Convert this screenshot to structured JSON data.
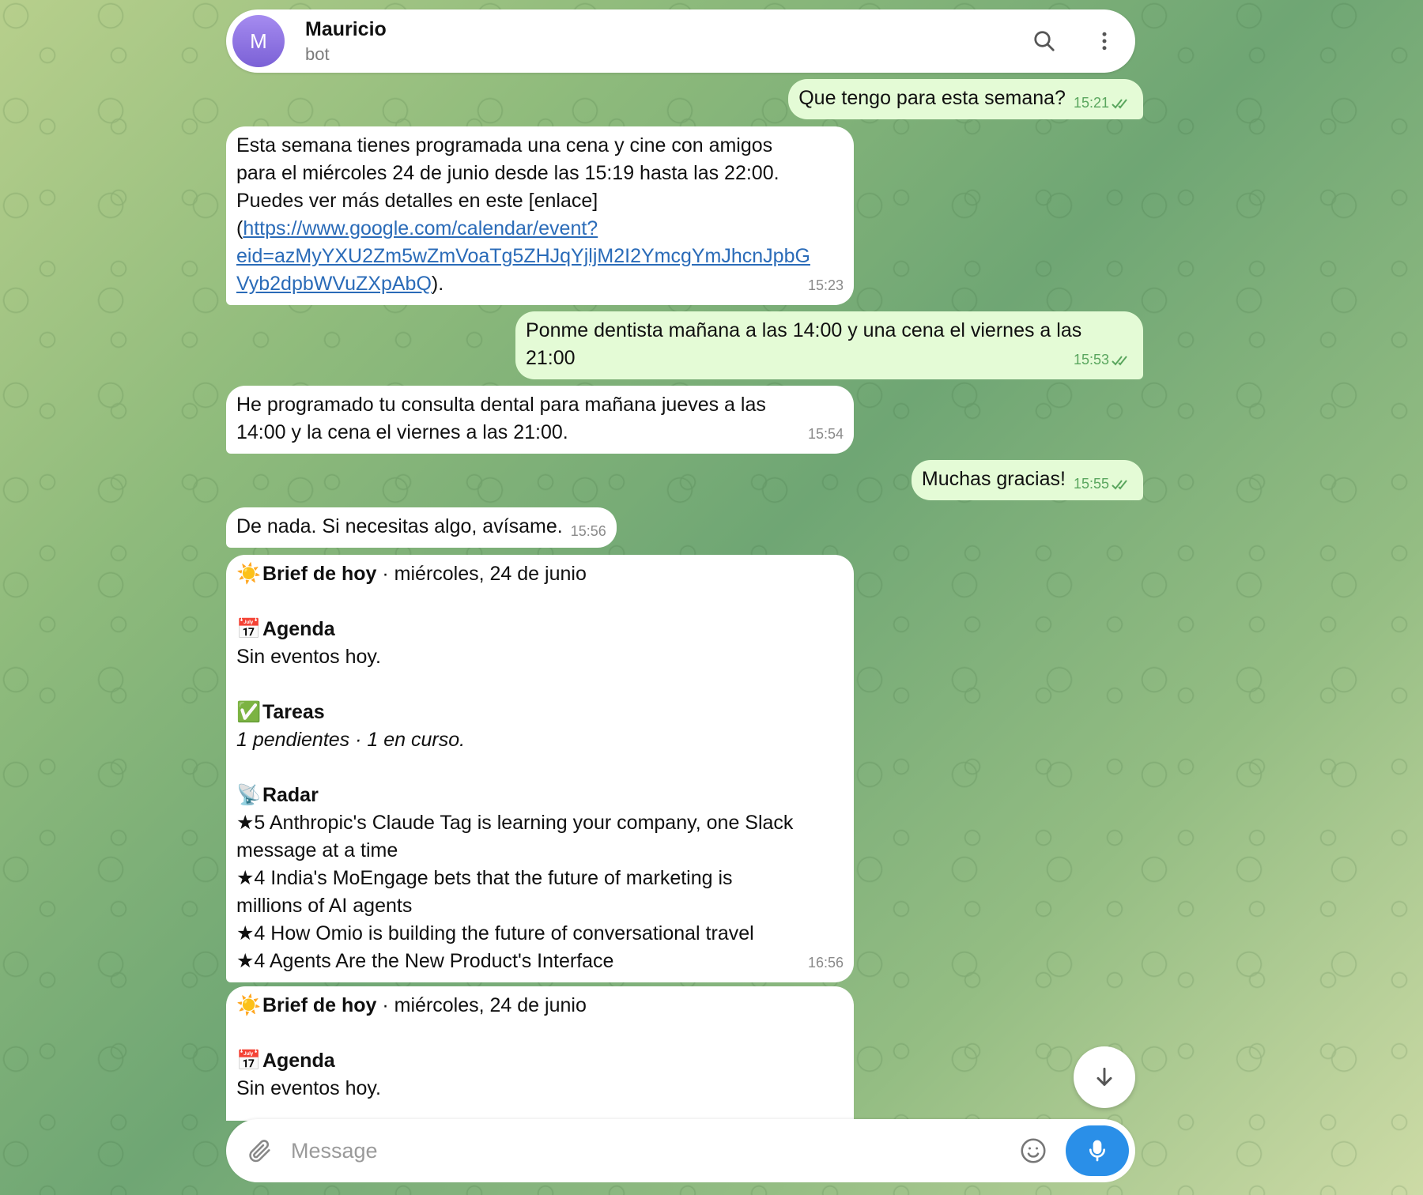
{
  "header": {
    "avatar_letter": "M",
    "name": "Mauricio",
    "subtitle": "bot"
  },
  "messages": {
    "m1": {
      "text": "Que tengo para esta semana?",
      "time": "15:21"
    },
    "m2": {
      "line1": "Esta semana tienes programada una cena y cine con amigos",
      "line2": "para el miércoles 24 de junio desde las 15:19 hasta las 22:00.",
      "line3": "Puedes ver más detalles en este [enlace]",
      "link_open": "(",
      "link_a": "https://www.google.com/calendar/event?",
      "link_b": "eid=azMyYXU2Zm5wZmVoaTg5ZHJqYjljM2I2YmcgYmJhcnJpbG",
      "link_c": "Vyb2dpbWVuZXpAbQ",
      "link_close": ").",
      "time": "15:23"
    },
    "m3": {
      "line1": "Ponme dentista mañana a las 14:00 y una cena el viernes a las",
      "line2": "21:00",
      "time": "15:53"
    },
    "m4": {
      "line1": "He programado tu consulta dental para mañana jueves a las",
      "line2": "14:00 y la cena el viernes a las 21:00.",
      "time": "15:54"
    },
    "m5": {
      "text": "Muchas gracias!",
      "time": "15:55"
    },
    "m6": {
      "text": "De nada. Si necesitas algo, avísame.",
      "time": "15:56"
    },
    "m7": {
      "sun": "☀️",
      "title_bold": "Brief de hoy",
      "title_rest": " · miércoles, 24 de junio",
      "cal": "📅",
      "agenda": "Agenda",
      "agenda_text": "Sin eventos hoy.",
      "check": "✅",
      "tasks": "Tareas",
      "tasks_text": "1 pendientes · 1 en curso.",
      "radar_icon": "📡",
      "radar": "Radar",
      "r1": "★5  Anthropic's Claude Tag is learning your company, one Slack",
      "r1b": "message at a time",
      "r2": "★4  India's MoEngage bets that the future of marketing is",
      "r2b": "millions of AI agents",
      "r3": "★4  How Omio is building the future of conversational travel",
      "r4": "★4  Agents Are the New Product's Interface",
      "time": "16:56"
    },
    "m8": {
      "sun": "☀️",
      "title_bold": "Brief de hoy",
      "title_rest": " · miércoles, 24 de junio",
      "cal": "📅",
      "agenda": "Agenda",
      "agenda_text": "Sin eventos hoy."
    }
  },
  "composer": {
    "placeholder": "Message"
  },
  "colors": {
    "outgoing": "#e4fbd6",
    "incoming": "#ffffff",
    "accent": "#2a8fe8",
    "check": "#5aa65e",
    "link": "#2a6bb8"
  },
  "icons": [
    "search-icon",
    "more-vertical-icon",
    "double-check-icon",
    "arrow-down-icon",
    "attach-icon",
    "emoji-icon",
    "mic-icon"
  ]
}
